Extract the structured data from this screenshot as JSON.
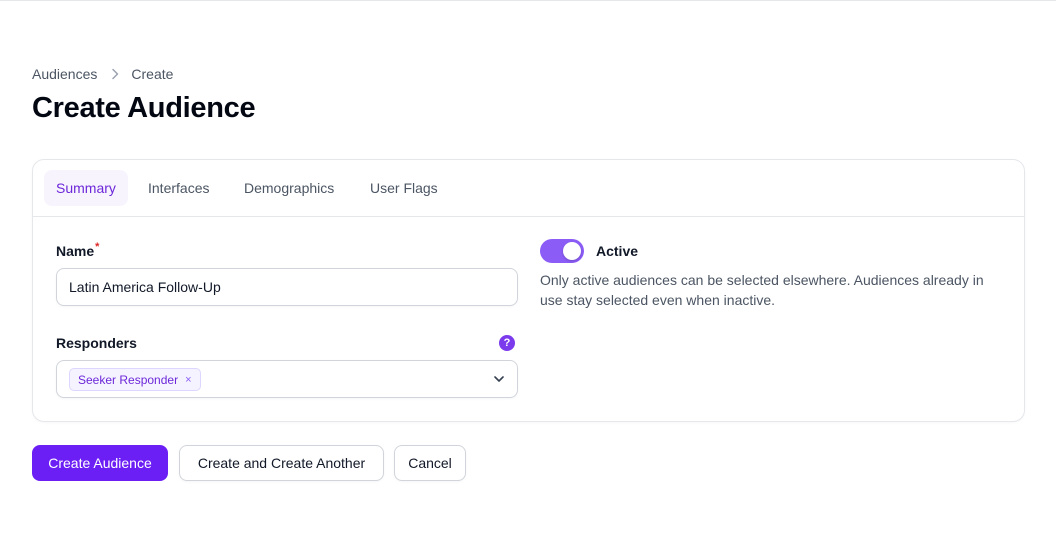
{
  "breadcrumb": {
    "parent": "Audiences",
    "current": "Create"
  },
  "page_title": "Create Audience",
  "tabs": [
    {
      "label": "Summary",
      "active": true
    },
    {
      "label": "Interfaces",
      "active": false
    },
    {
      "label": "Demographics",
      "active": false
    },
    {
      "label": "User Flags",
      "active": false
    }
  ],
  "form": {
    "name": {
      "label": "Name",
      "required_mark": "*",
      "value": "Latin America Follow-Up"
    },
    "responders": {
      "label": "Responders",
      "help_icon": "?",
      "selected": [
        "Seeker Responder"
      ],
      "chip_remove": "×"
    },
    "active": {
      "label": "Active",
      "enabled": true,
      "help_text": "Only active audiences can be selected elsewhere. Audiences already in use stay selected even when inactive."
    }
  },
  "actions": {
    "create": "Create Audience",
    "create_another": "Create and Create Another",
    "cancel": "Cancel"
  },
  "colors": {
    "primary": "#6b1ff5",
    "accent": "#7c3aed",
    "toggle_on": "#8b5cf6",
    "required": "#dc2626"
  }
}
